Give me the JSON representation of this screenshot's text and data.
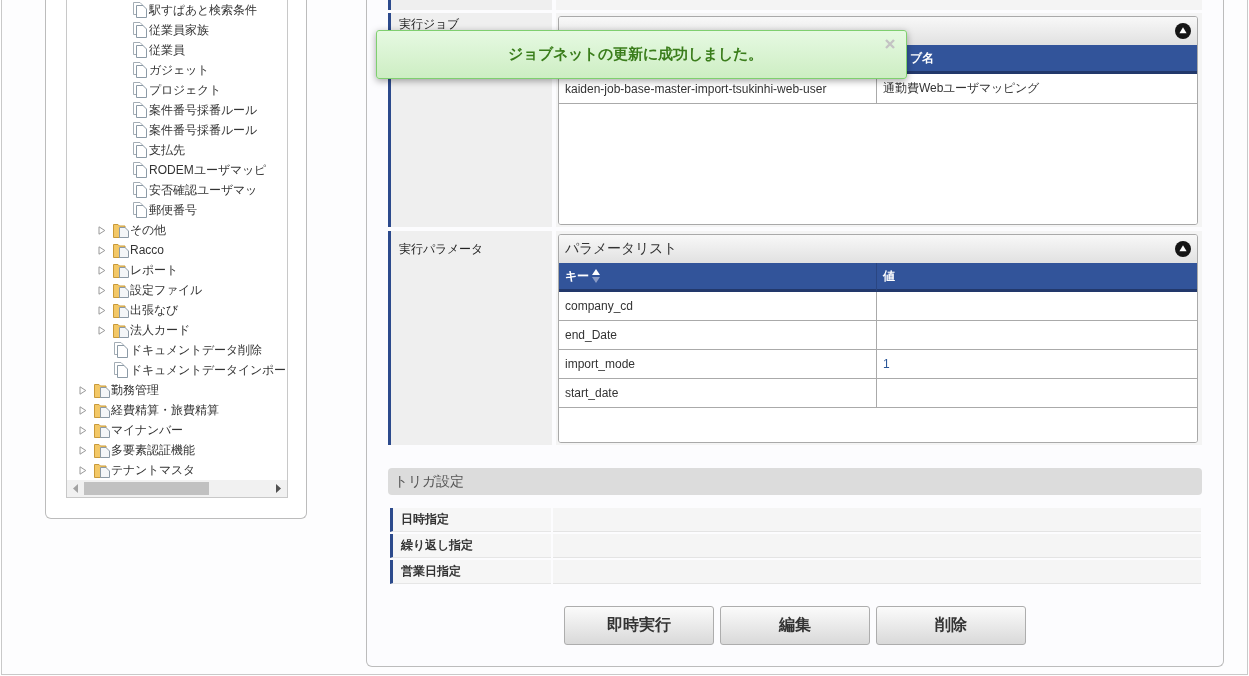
{
  "tree": {
    "items": [
      {
        "children": [
          {
            "children": [
              {
                "kind": "document",
                "label": "駅すぱあと検索条件"
              },
              {
                "kind": "document",
                "label": "従業員家族"
              },
              {
                "kind": "document",
                "label": "従業員"
              },
              {
                "kind": "document",
                "label": "ガジェット"
              },
              {
                "kind": "document",
                "label": "プロジェクト"
              },
              {
                "kind": "document",
                "label": "案件番号採番ルール"
              },
              {
                "kind": "document",
                "label": "案件番号採番ルール"
              },
              {
                "kind": "document",
                "label": "支払先"
              },
              {
                "kind": "document",
                "label": "RODEMユーザマッピ"
              },
              {
                "kind": "document",
                "label": "安否確認ユーザマッ"
              },
              {
                "kind": "document",
                "label": "郵便番号"
              }
            ]
          },
          {
            "kind": "folder",
            "label": "その他",
            "expanded": false
          },
          {
            "kind": "folder",
            "label": "Racco",
            "expanded": false
          },
          {
            "kind": "folder",
            "label": "レポート",
            "expanded": false
          },
          {
            "kind": "folder",
            "label": "設定ファイル",
            "expanded": false
          },
          {
            "kind": "folder",
            "label": "出張なび",
            "expanded": false
          },
          {
            "kind": "folder",
            "label": "法人カード",
            "expanded": false
          },
          {
            "kind": "document",
            "label": "ドキュメントデータ削除"
          },
          {
            "kind": "document",
            "label": "ドキュメントデータインポー"
          }
        ]
      },
      {
        "kind": "folder",
        "label": "勤務管理",
        "expanded": false
      },
      {
        "kind": "folder",
        "label": "経費精算・旅費精算",
        "expanded": false
      },
      {
        "kind": "folder",
        "label": "マイナンバー",
        "expanded": false
      },
      {
        "kind": "folder",
        "label": "多要素認証機能",
        "expanded": false
      },
      {
        "kind": "folder",
        "label": "テナントマスタ",
        "expanded": false
      }
    ]
  },
  "toast": {
    "message": "ジョブネットの更新に成功しました。"
  },
  "job": {
    "label": "実行ジョブ",
    "panel": {
      "expanded": true,
      "column_2_heading": "ブ名",
      "rows": [
        {
          "column_1": "kaiden-job-base-master-import-tsukinhi-web-user",
          "column_2": "通勤費Webユーザマッピング"
        }
      ]
    }
  },
  "parameters": {
    "label": "実行パラメータ",
    "panel": {
      "title": "パラメータリスト",
      "expanded": true,
      "columns": [
        {
          "label": "キー",
          "sorted": true
        },
        {
          "label": "値",
          "sorted": false
        }
      ],
      "rows": [
        {
          "key": "company_cd"
        },
        {
          "key": "end_Date"
        },
        {
          "key": "import_mode",
          "value": "1"
        },
        {
          "key": "start_date"
        }
      ]
    }
  },
  "trigger": {
    "title": "トリガ設定",
    "rows": [
      {
        "label": "日時指定"
      },
      {
        "label": "繰り返し指定"
      },
      {
        "label": "営業日指定"
      }
    ]
  },
  "buttons": [
    {
      "label": "即時実行"
    },
    {
      "label": "編集"
    },
    {
      "label": "削除"
    }
  ]
}
